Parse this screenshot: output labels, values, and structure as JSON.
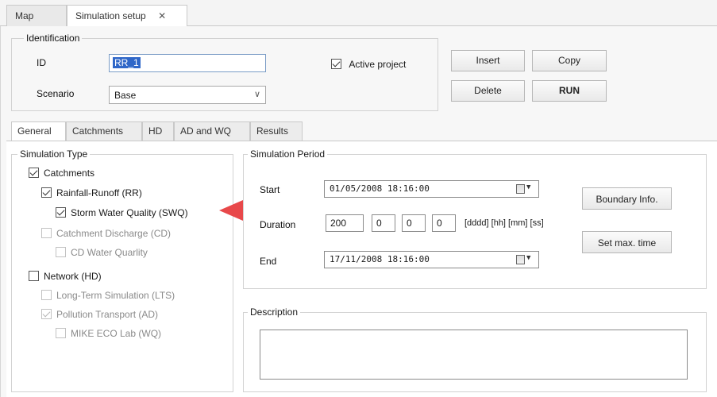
{
  "doc_tabs": [
    {
      "label": "Map"
    },
    {
      "label": "Simulation setup"
    }
  ],
  "identification": {
    "legend": "Identification",
    "id_label": "ID",
    "id_value": "RR_1",
    "scenario_label": "Scenario",
    "scenario_value": "Base",
    "active_project_label": "Active project",
    "active_project_checked": true
  },
  "buttons": {
    "insert": "Insert",
    "copy": "Copy",
    "delete": "Delete",
    "run": "RUN"
  },
  "sub_tabs": [
    {
      "label": "General"
    },
    {
      "label": "Catchments"
    },
    {
      "label": "HD"
    },
    {
      "label": "AD and WQ"
    },
    {
      "label": "Results"
    }
  ],
  "simulation_type": {
    "legend": "Simulation Type",
    "items": [
      {
        "label": "Catchments",
        "checked": true,
        "enabled": true
      },
      {
        "label": "Rainfall-Runoff (RR)",
        "checked": true,
        "enabled": true
      },
      {
        "label": "Storm Water Quality (SWQ)",
        "checked": true,
        "enabled": true
      },
      {
        "label": "Catchment Discharge (CD)",
        "checked": false,
        "enabled": false
      },
      {
        "label": "CD Water Quarlity",
        "checked": false,
        "enabled": false
      },
      {
        "label": "Network (HD)",
        "checked": false,
        "enabled": true
      },
      {
        "label": "Long-Term Simulation (LTS)",
        "checked": false,
        "enabled": false
      },
      {
        "label": "Pollution Transport (AD)",
        "checked": true,
        "enabled": false
      },
      {
        "label": "MIKE ECO Lab (WQ)",
        "checked": false,
        "enabled": false
      }
    ]
  },
  "simulation_period": {
    "legend": "Simulation Period",
    "start_label": "Start",
    "start_value": "01/05/2008 18:16:00",
    "duration_label": "Duration",
    "duration_days": "200",
    "duration_hours": "0",
    "duration_minutes": "0",
    "duration_seconds": "0",
    "duration_format": "[dddd] [hh] [mm] [ss]",
    "end_label": "End",
    "end_value": "17/11/2008 18:16:00",
    "boundary_button": "Boundary Info.",
    "max_time_button": "Set max. time"
  },
  "description": {
    "legend": "Description",
    "value": ""
  },
  "colors": {
    "annotation_arrow": "#e8484a",
    "selection": "#2f67c8"
  }
}
